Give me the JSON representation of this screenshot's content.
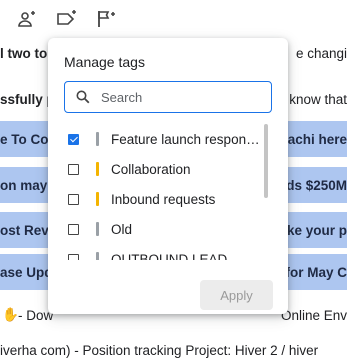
{
  "colors": {
    "accent": "#1a73e8",
    "row_highlight": "#adc6f0",
    "tag_gray": "#9aa0a6",
    "tag_yellow": "#f4b400"
  },
  "toolbar": {
    "icons": [
      "add-contact-icon",
      "label-add-icon",
      "flag-add-icon"
    ]
  },
  "background_rows": [
    {
      "left": "l two to",
      "right": "e changi",
      "style": "white"
    },
    {
      "left": "ssfully p",
      "right": "know that",
      "style": "white"
    },
    {
      "left": "e To Co",
      "right": "achi here",
      "style": "blue"
    },
    {
      "left": "on may",
      "right": "ds $250M",
      "style": "blue"
    },
    {
      "left": "ost Rev",
      "right": "ke your p",
      "style": "blue"
    },
    {
      "left": "ase Upd",
      "right": "for May C",
      "style": "blue"
    },
    {
      "left": "- Dow",
      "right": "Online Env",
      "style": "white"
    },
    {
      "left": "iverha com) - Position tracking Project: Hiver 2 / hiver",
      "right": "",
      "style": "white"
    }
  ],
  "popover": {
    "title": "Manage tags",
    "search": {
      "value": "",
      "placeholder": "Search"
    },
    "tags": [
      {
        "label": "Feature launch respons...",
        "checked": true,
        "color": "#9aa0a6"
      },
      {
        "label": "Collaboration",
        "checked": false,
        "color": "#f4b400"
      },
      {
        "label": "Inbound requests",
        "checked": false,
        "color": "#f4b400"
      },
      {
        "label": "Old",
        "checked": false,
        "color": "#9aa0a6"
      },
      {
        "label": "OUTBOUND LEAD",
        "checked": false,
        "color": "#9aa0a6"
      }
    ],
    "apply_label": "Apply"
  }
}
